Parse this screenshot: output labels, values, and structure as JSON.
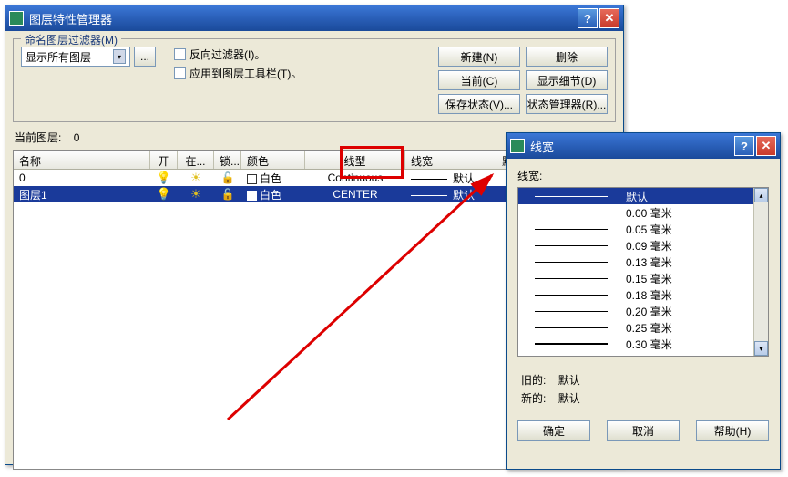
{
  "main_window": {
    "title": "图层特性管理器",
    "filter_legend": "命名图层过滤器(M)",
    "filter_combo": "显示所有图层",
    "browse": "...",
    "chk_invert": "反向过滤器(I)。",
    "chk_toolbar": "应用到图层工具栏(T)。",
    "btn_new": "新建(N)",
    "btn_delete": "删除",
    "btn_current": "当前(C)",
    "btn_detail": "显示细节(D)",
    "btn_savestate": "保存状态(V)...",
    "btn_statemgr": "状态管理器(R)...",
    "current_label": "当前图层:",
    "current_value": "0",
    "columns": {
      "name": "名称",
      "on": "开",
      "freeze": "在...",
      "lock": "锁...",
      "color": "颜色",
      "ltype": "线型",
      "lweight": "线宽",
      "pstyle": "默认"
    },
    "rows": [
      {
        "name": "0",
        "color_swatch": "#ffffff",
        "color": "白色",
        "ltype": "Continuous",
        "lweight": "默认"
      },
      {
        "name": "图层1",
        "color_swatch": "#ffffff",
        "color": "白色",
        "ltype": "CENTER",
        "lweight": "默认"
      }
    ]
  },
  "lw_window": {
    "title": "线宽",
    "label": "线宽:",
    "items": [
      {
        "label": "默认",
        "thick": 1,
        "sel": true
      },
      {
        "label": "0.00 毫米",
        "thick": 1
      },
      {
        "label": "0.05 毫米",
        "thick": 1
      },
      {
        "label": "0.09 毫米",
        "thick": 1
      },
      {
        "label": "0.13 毫米",
        "thick": 1
      },
      {
        "label": "0.15 毫米",
        "thick": 1
      },
      {
        "label": "0.18 毫米",
        "thick": 1
      },
      {
        "label": "0.20 毫米",
        "thick": 1
      },
      {
        "label": "0.25 毫米",
        "thick": 2
      },
      {
        "label": "0.30 毫米",
        "thick": 2
      }
    ],
    "old_label": "旧的:",
    "old_value": "默认",
    "new_label": "新的:",
    "new_value": "默认",
    "btn_ok": "确定",
    "btn_cancel": "取消",
    "btn_help": "帮助(H)"
  }
}
